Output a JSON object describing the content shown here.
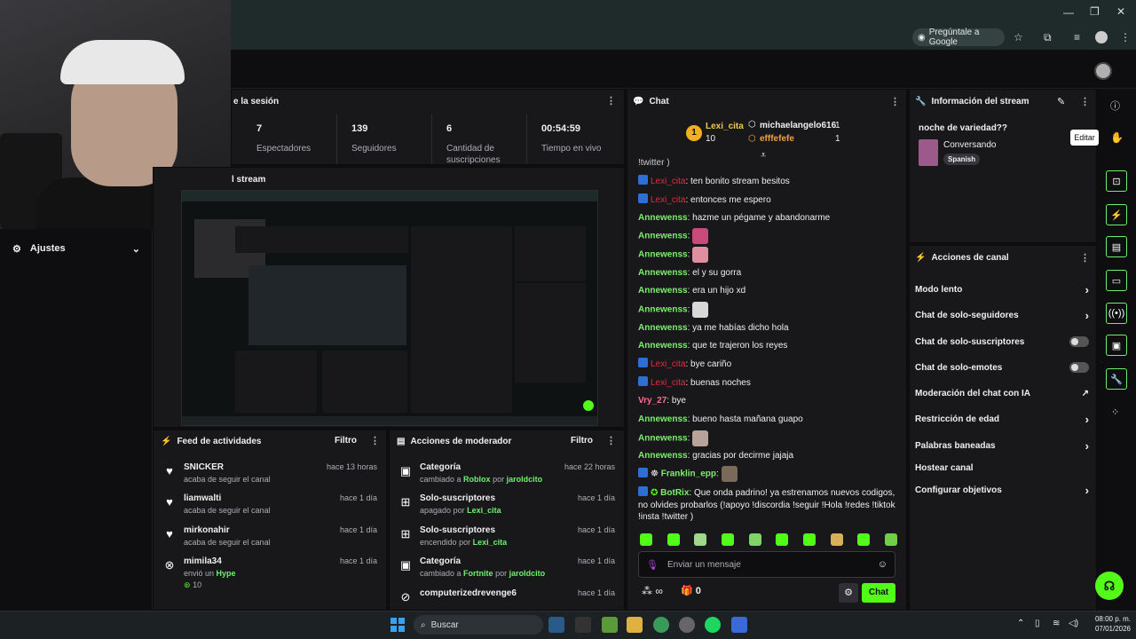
{
  "browser": {
    "ask_google_label": "Pregúntale a Google"
  },
  "sidebar": {
    "settings_label": "Ajustes"
  },
  "session": {
    "title_partial": "e la sesión",
    "stats": [
      {
        "value": "7",
        "label": "Espectadores"
      },
      {
        "value": "139",
        "label": "Seguidores"
      },
      {
        "value": "6",
        "label": "Cantidad de suscripciones"
      },
      {
        "value": "00:54:59",
        "label": "Tiempo en vivo"
      }
    ]
  },
  "preview": {
    "title_partial": "l stream"
  },
  "feed": {
    "title": "Feed de actividades",
    "filter_label": "Filtro",
    "items": [
      {
        "icon": "heart-icon",
        "name": "SNICKER",
        "sub": "acaba de seguir el canal",
        "time": "hace 13 horas"
      },
      {
        "icon": "heart-icon",
        "name": "liamwalti",
        "sub": "acaba de seguir el canal",
        "time": "hace 1 día"
      },
      {
        "icon": "heart-icon",
        "name": "mirkonahir",
        "sub": "acaba de seguir el canal",
        "time": "hace 1 día"
      },
      {
        "icon": "kick-icon",
        "name": "mimila34",
        "sub_prefix": "envió un",
        "sub_hl": "Hype",
        "amount": "10",
        "time": "hace 1 día"
      }
    ]
  },
  "moderator": {
    "title": "Acciones de moderador",
    "filter_label": "Filtro",
    "items": [
      {
        "icon": "category-icon",
        "name": "Categoría",
        "sub_prefix": "cambiado a",
        "sub_hl": "Roblox",
        "by": "por",
        "user": "jaroldcito",
        "time": "hace 22 horas"
      },
      {
        "icon": "gift-icon",
        "name": "Solo-suscriptores",
        "sub_prefix": "apagado",
        "by": "por",
        "user": "Lexi_cita",
        "time": "hace 1 día"
      },
      {
        "icon": "gift-icon",
        "name": "Solo-suscriptores",
        "sub_prefix": "encendido",
        "by": "por",
        "user": "Lexi_cita",
        "time": "hace 1 día"
      },
      {
        "icon": "category-icon",
        "name": "Categoría",
        "sub_prefix": "cambiado a",
        "sub_hl": "Fortnite",
        "by": "por",
        "user": "jaroldcito",
        "time": "hace 1 día"
      },
      {
        "icon": "ban-icon",
        "name": "computerizedrevenge6",
        "time": "hace 1 día"
      }
    ]
  },
  "chat": {
    "title": "Chat",
    "top_gifter": {
      "name": "Lexi_cita",
      "count": "10",
      "rank": "1"
    },
    "leaders": [
      {
        "name": "michaelangelo616",
        "count": "1"
      },
      {
        "name": "efffefefe",
        "count": "1"
      }
    ],
    "partial_top": "!twitter )",
    "messages": [
      {
        "user": "Lexi_cita",
        "style": "red",
        "mod": true,
        "text": ": ten bonito stream besitos"
      },
      {
        "user": "Lexi_cita",
        "style": "red",
        "mod": true,
        "text": ": entonces me espero"
      },
      {
        "user": "Annewenss",
        "style": "green",
        "text": ": hazme un pégame y abandonarme"
      },
      {
        "user": "Annewenss",
        "style": "green",
        "text": ":",
        "emote": "#c94a7a"
      },
      {
        "user": "Annewenss",
        "style": "green",
        "text": ":",
        "emote": "#e08fa0"
      },
      {
        "user": "Annewenss",
        "style": "green",
        "text": ": el y su gorra"
      },
      {
        "user": "Annewenss",
        "style": "green",
        "text": ": era un hijo xd"
      },
      {
        "user": "Annewenss",
        "style": "green",
        "text": ":",
        "emote": "#d8d8d8"
      },
      {
        "user": "Annewenss",
        "style": "green",
        "text": ": ya me habías dicho hola"
      },
      {
        "user": "Annewenss",
        "style": "green",
        "text": ": que te trajeron los reyes"
      },
      {
        "user": "Lexi_cita",
        "style": "red",
        "mod": true,
        "text": ": bye cariño"
      },
      {
        "user": "Lexi_cita",
        "style": "red",
        "mod": true,
        "text": ": buenas noches"
      },
      {
        "user": "Vry_27",
        "style": "pink",
        "text": ": bye"
      },
      {
        "user": "Annewenss",
        "style": "green",
        "text": ": bueno hasta mañana guapo"
      },
      {
        "user": "Annewenss",
        "style": "green",
        "text": ":",
        "emote": "#b9a29a"
      },
      {
        "user": "Annewenss",
        "style": "green",
        "text": ": gracias por decirme jajaja"
      },
      {
        "user": "Franklin_epp",
        "style": "green",
        "mod": true,
        "text": ":",
        "emote": "#7a6a5a"
      },
      {
        "user": "BotRix",
        "style": "green",
        "mod": true,
        "text": ": Que onda padrino! ya estrenamos nuevos codigos, no olvides probarlos (!apoyo !discordia !seguir !Hola !redes !tiktok !insta !twitter )"
      }
    ],
    "input_placeholder": "Enviar un mensaje",
    "infinite_label": "∞",
    "gift_count": "0",
    "send_label": "Chat"
  },
  "stream_info": {
    "title": "Información del stream",
    "stream_title": "noche de variedad??",
    "category": "Conversando",
    "language": "Spanish"
  },
  "channel_actions": {
    "title": "Acciones de canal",
    "items": [
      {
        "label": "Modo lento",
        "control": "chevron"
      },
      {
        "label": "Chat de solo-seguidores",
        "control": "chevron"
      },
      {
        "label": "Chat de solo-suscriptores",
        "control": "toggle"
      },
      {
        "label": "Chat de solo-emotes",
        "control": "toggle"
      },
      {
        "label": "Moderación del chat con IA",
        "control": "external"
      },
      {
        "label": "Restricción de edad",
        "control": "chevron"
      },
      {
        "label": "Palabras baneadas",
        "control": "chevron"
      },
      {
        "label": "Hostear canal",
        "control": "none"
      },
      {
        "label": "Configurar objetivos",
        "control": "chevron"
      }
    ]
  },
  "tooltip": {
    "label": "Editar"
  },
  "taskbar": {
    "search_label": "Buscar",
    "time": "08:00 p. m.",
    "date": "07/01/2026"
  },
  "colors": {
    "accent": "#53fc18",
    "panel": "#18181b",
    "background": "#0e0e10"
  }
}
